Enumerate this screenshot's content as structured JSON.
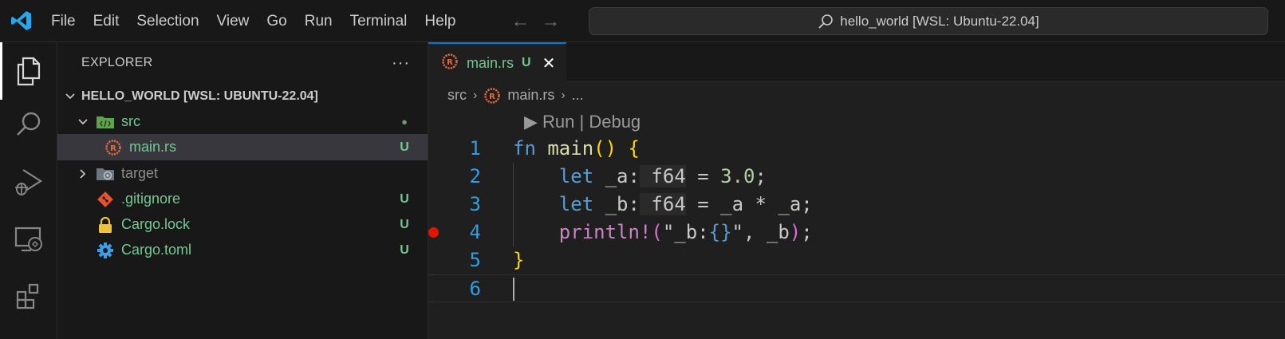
{
  "menu": {
    "items": [
      "File",
      "Edit",
      "Selection",
      "View",
      "Go",
      "Run",
      "Terminal",
      "Help"
    ]
  },
  "command_center": {
    "label": "hello_world [WSL: Ubuntu-22.04]"
  },
  "activity_bar": {
    "items": [
      "explorer-icon",
      "search-icon",
      "run-debug-icon",
      "remote-explorer-icon",
      "extensions-icon"
    ]
  },
  "explorer": {
    "title": "EXPLORER",
    "more": "···",
    "root": "HELLO_WORLD [WSL: UBUNTU-22.04]",
    "items": [
      {
        "name": "src",
        "decor": "●",
        "color": "#73c991"
      },
      {
        "name": "main.rs",
        "decor": "U",
        "color": "#73c991"
      },
      {
        "name": "target",
        "decor": "",
        "color": "#8c8c8c"
      },
      {
        "name": ".gitignore",
        "decor": "U",
        "color": "#73c991"
      },
      {
        "name": "Cargo.lock",
        "decor": "U",
        "color": "#73c991"
      },
      {
        "name": "Cargo.toml",
        "decor": "U",
        "color": "#73c991"
      }
    ]
  },
  "editor": {
    "tab": {
      "label": "main.rs",
      "badge": "U",
      "close": "✕"
    },
    "breadcrumb": {
      "folder": "src",
      "file": "main.rs",
      "more": "..."
    },
    "codelens": "▶ Run | Debug",
    "line_numbers": [
      "1",
      "2",
      "3",
      "4",
      "5",
      "6"
    ],
    "code": {
      "l1": {
        "kw": "fn",
        "name": " main",
        "open": "()",
        "brace": " {"
      },
      "l2": {
        "kw": "let",
        "var": " _a",
        "colon": ":",
        "ty": " f64",
        "eq": " = ",
        "num": "3.0",
        "end": ";"
      },
      "l3": {
        "kw": "let",
        "var": " _b",
        "colon": ":",
        "ty": " f64",
        "eq": " = ",
        "expr": "_a * _a",
        "end": ";"
      },
      "l4": {
        "mac": "println!",
        "open": "(",
        "str1": "\"_b:",
        "fmt": "{}",
        "str2": "\"",
        "args": ", _b",
        "close": ")",
        "end": ";"
      },
      "l5": {
        "brace": "}"
      }
    }
  },
  "colors": {
    "accent": "#0078d4",
    "git_untracked": "#73c991",
    "breakpoint": "#e51400",
    "rust_icon": "#e8693f"
  }
}
